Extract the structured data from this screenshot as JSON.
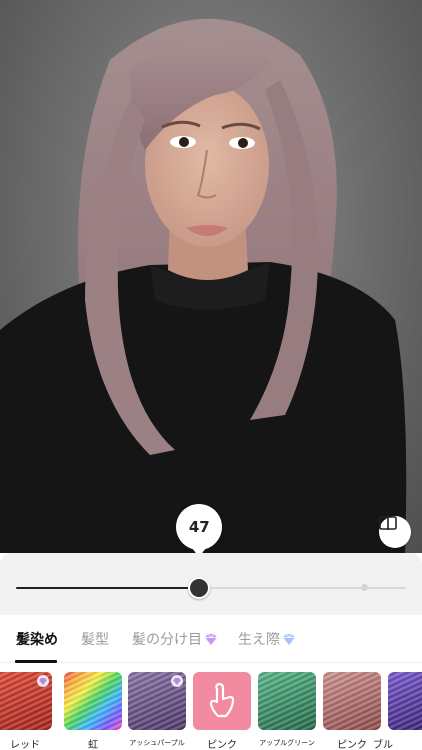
{
  "editor": {
    "intensity": {
      "value": 47,
      "value_label": "47",
      "max": 100,
      "default_marker": 89
    },
    "compare_icon": "compare-icon"
  },
  "tabs": [
    {
      "label": "髪染め",
      "active": true,
      "premium": false
    },
    {
      "label": "髪型",
      "active": false,
      "premium": false
    },
    {
      "label": "髪の分け目",
      "active": false,
      "premium": true
    },
    {
      "label": "生え際",
      "active": false,
      "premium": true
    }
  ],
  "colors": {
    "accent": "#222222",
    "track": "#d9d9d9",
    "tab_active": "#111111",
    "tab_inactive": "#9b9b9b"
  },
  "swatches": [
    {
      "label": "レッド",
      "premium": true,
      "fill": "#c0392b"
    },
    {
      "label": "虹",
      "premium": false,
      "fill": "rainbow"
    },
    {
      "label": "アッシュパープル",
      "premium": true,
      "fill": "#6a4f8a"
    },
    {
      "label": "ピンク",
      "premium": false,
      "fill": "#f07f9a",
      "selected": true
    },
    {
      "label": "アップルグリーン",
      "premium": false,
      "fill": "#3e9a6e"
    },
    {
      "label": "ピンク",
      "premium": false,
      "fill": "#b9726f"
    },
    {
      "label": "ブル",
      "premium": false,
      "fill": "#5a3fa0"
    }
  ]
}
